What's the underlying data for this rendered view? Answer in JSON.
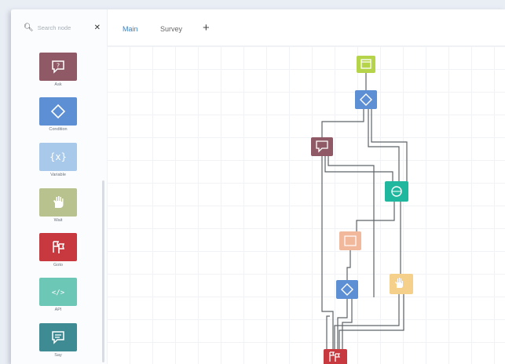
{
  "search": {
    "placeholder": "Search node",
    "clear_icon": "close-icon"
  },
  "tabs": [
    {
      "label": "Main",
      "active": true
    },
    {
      "label": "Survey",
      "active": false
    }
  ],
  "add_tab_icon": "plus-icon",
  "palette": [
    {
      "label": "Ask",
      "color": "#8f5a66",
      "icon": "question-bubble-icon"
    },
    {
      "label": "Condition",
      "color": "#5d8fd4",
      "icon": "diamond-icon"
    },
    {
      "label": "Variable",
      "color": "#a9c9ea",
      "icon": "braces-icon"
    },
    {
      "label": "Wait",
      "color": "#b7c28e",
      "icon": "hand-icon"
    },
    {
      "label": "Goto",
      "color": "#c8383f",
      "icon": "flags-icon"
    },
    {
      "label": "API",
      "color": "#6dc7b6",
      "icon": "code-icon"
    },
    {
      "label": "Say",
      "color": "#3f8b94",
      "icon": "chat-icon"
    }
  ],
  "colors": {
    "accent": "#3b82c4",
    "start": "#b6d44a",
    "condition": "#5d8fd4",
    "ask": "#8f5a66",
    "api": "#1fb89e",
    "variable": "#f2b89c",
    "wait": "#f5d08a",
    "goto": "#c8383f"
  }
}
